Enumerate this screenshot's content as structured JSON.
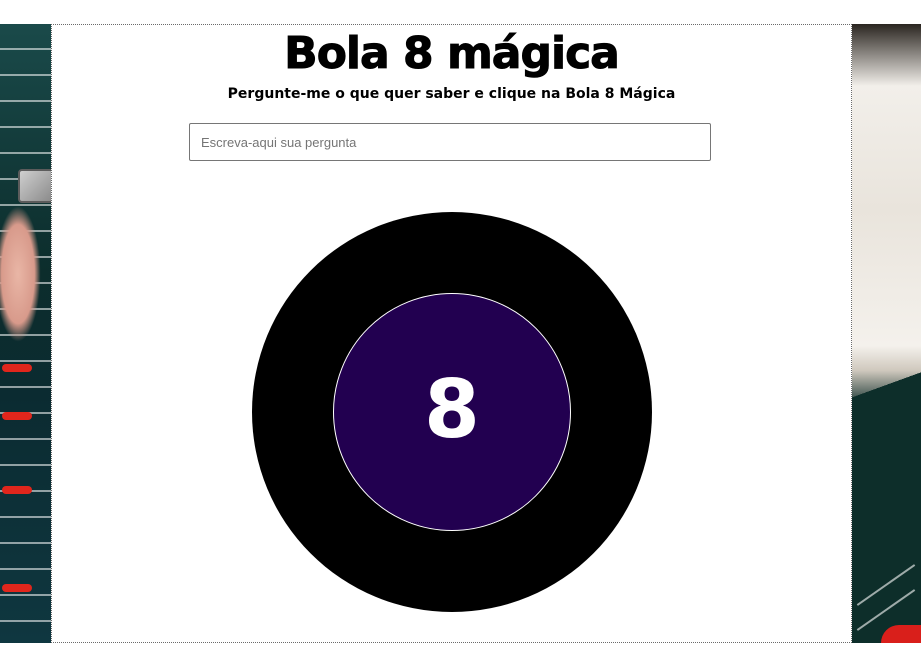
{
  "app": {
    "title": "Bola 8 mágica",
    "subtitle": "Pergunte-me o que quer saber e clique na Bola 8 Mágica"
  },
  "question": {
    "placeholder": "Escreva-aqui sua pergunta",
    "value": ""
  },
  "ball": {
    "label": "8",
    "outer_color": "#000000",
    "window_color": "#220050",
    "text_color": "#ffffff"
  },
  "background": {
    "description_icon": "casino-roulette-photo"
  }
}
